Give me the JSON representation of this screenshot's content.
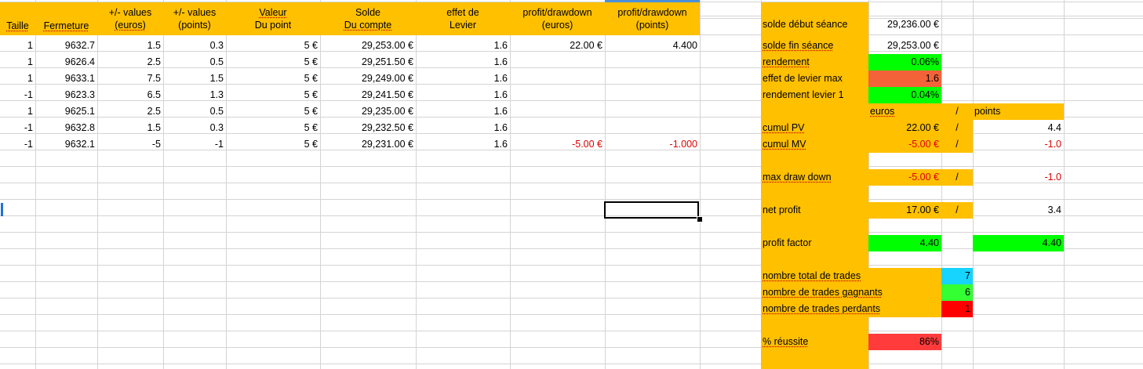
{
  "headers": {
    "taille": "Taille",
    "fermeture": "Fermeture",
    "values_euros": [
      "+/- values",
      "(euros)"
    ],
    "values_points": [
      "+/- values",
      "(points)"
    ],
    "valeur_point": [
      "Valeur",
      "Du point"
    ],
    "solde_compte": [
      "Solde",
      "Du compte"
    ],
    "effet_levier": [
      "effet de",
      "Levier"
    ],
    "profit_euros": [
      "profit/drawdown",
      "(euros)"
    ],
    "profit_points": [
      "profit/drawdown",
      "(points)"
    ]
  },
  "trades": [
    {
      "taille": "1",
      "fermeture": "9632.7",
      "val_eur": "1.5",
      "val_pts": "0.3",
      "valeur": "5 €",
      "solde": "29,253.00 €",
      "levier": "1.6",
      "profit_eur": "22.00 €",
      "profit_pts": "4.400"
    },
    {
      "taille": "1",
      "fermeture": "9626.4",
      "val_eur": "2.5",
      "val_pts": "0.5",
      "valeur": "5 €",
      "solde": "29,251.50 €",
      "levier": "1.6",
      "profit_eur": "",
      "profit_pts": ""
    },
    {
      "taille": "1",
      "fermeture": "9633.1",
      "val_eur": "7.5",
      "val_pts": "1.5",
      "valeur": "5 €",
      "solde": "29,249.00 €",
      "levier": "1.6",
      "profit_eur": "",
      "profit_pts": ""
    },
    {
      "taille": "-1",
      "fermeture": "9623.3",
      "val_eur": "6.5",
      "val_pts": "1.3",
      "valeur": "5 €",
      "solde": "29,241.50 €",
      "levier": "1.6",
      "profit_eur": "",
      "profit_pts": ""
    },
    {
      "taille": "1",
      "fermeture": "9625.1",
      "val_eur": "2.5",
      "val_pts": "0.5",
      "valeur": "5 €",
      "solde": "29,235.00 €",
      "levier": "1.6",
      "profit_eur": "",
      "profit_pts": ""
    },
    {
      "taille": "-1",
      "fermeture": "9632.8",
      "val_eur": "1.5",
      "val_pts": "0.3",
      "valeur": "5 €",
      "solde": "29,232.50 €",
      "levier": "1.6",
      "profit_eur": "",
      "profit_pts": ""
    },
    {
      "taille": "-1",
      "fermeture": "9632.1",
      "val_eur": "-5",
      "val_pts": "-1",
      "valeur": "5 €",
      "solde": "29,231.00 €",
      "levier": "1.6",
      "profit_eur": "-5.00 €",
      "profit_pts": "-1.000"
    }
  ],
  "summary": {
    "solde_debut_label": "solde début séance",
    "solde_debut_value": "29,236.00 €",
    "solde_fin_label": "solde fin séance",
    "solde_fin_value": "29,253.00 €",
    "rendement_label": "rendement",
    "rendement_value": "0.06%",
    "levier_max_label": "effet de levier max",
    "levier_max_value": "1.6",
    "rendement_levier_label": "rendement levier 1",
    "rendement_levier_value": "0.04%",
    "euros_label": "euros",
    "slash": "/",
    "points_label": "points",
    "cumul_pv_label": "cumul PV",
    "cumul_pv_euros": "22.00 €",
    "cumul_pv_points": "4.4",
    "cumul_mv_label": "cumul MV",
    "cumul_mv_euros": "-5.00 €",
    "cumul_mv_points": "-1.0",
    "max_dd_label": "max draw down",
    "max_dd_euros": "-5.00 €",
    "max_dd_points": "-1.0",
    "net_profit_label": "net profit",
    "net_profit_euros": "17.00 €",
    "net_profit_points": "3.4",
    "profit_factor_label": "profit factor",
    "profit_factor_euros": "4.40",
    "profit_factor_points": "4.40",
    "total_trades_label": "nombre total de trades",
    "total_trades_value": "7",
    "gagnants_label": "nombre de trades gagnants",
    "gagnants_value": "6",
    "perdants_label": "nombre de trades perdants",
    "perdants_value": "1",
    "reussite_label": "% réussite",
    "reussite_value": "86%"
  },
  "colors": {
    "header_orange": "#FFC000",
    "green": "#00FF00",
    "light_green": "#33FF33",
    "orange_red": "#F4623A",
    "red": "#FF0000",
    "salmon": "#FF3B3B",
    "cyan": "#17D4FF",
    "negative_text": "#E00000",
    "selection_border": "#000000"
  }
}
